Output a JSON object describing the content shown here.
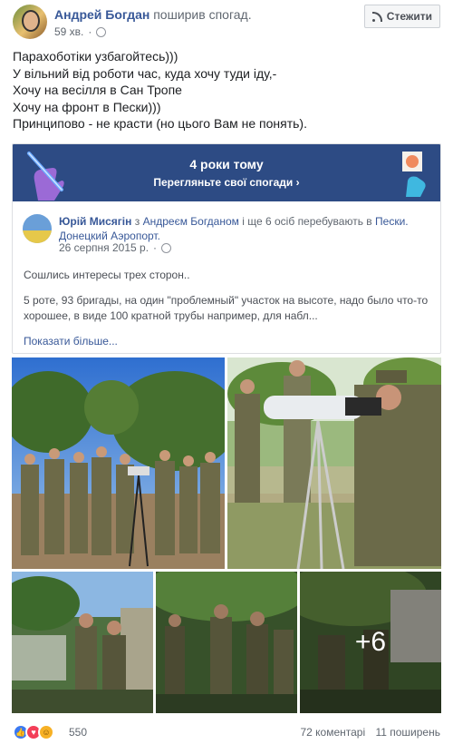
{
  "post": {
    "author": "Андрей Богдан",
    "action": "поширив спогад.",
    "time": "59 хв.",
    "follow_label": "Стежити",
    "text_lines": [
      "Парахоботіки узбагойтесь)))",
      "У вільний від роботи час, куда хочу туди іду,-",
      "Хочу на весілля в Сан Тропе",
      "Хочу на фронт в Пески)))",
      "Принципово - не красти (но цього Вам не понять)."
    ]
  },
  "memory": {
    "title": "4 роки тому",
    "link": "Перегляньте свої спогади",
    "link_arrow": "›"
  },
  "shared": {
    "author": "Юрій Мисягін",
    "with_word": "з",
    "with_name": "Андреєм Богданом",
    "and_text": "і ще 6 осіб",
    "location_prefix": "перебувають в",
    "location": "Пески. Донецкий Аэропорт.",
    "date": "26 серпня 2015 р.",
    "intro": "Сошлись интересы трех сторон..",
    "body": "5 роте, 93 бригады, на один \"проблемный\" участок на высоте, надо было что-то хорошее, в виде 100 кратной трубы например, для набл...",
    "more_label": "Показати більше...",
    "photo_more": "+6"
  },
  "footer": {
    "reactions_count": "550",
    "reactions": [
      "like",
      "love",
      "haha"
    ],
    "comments": "72 коментарі",
    "shares": "11 поширень"
  },
  "colors": {
    "link": "#385898",
    "banner": "#2d4b84"
  }
}
